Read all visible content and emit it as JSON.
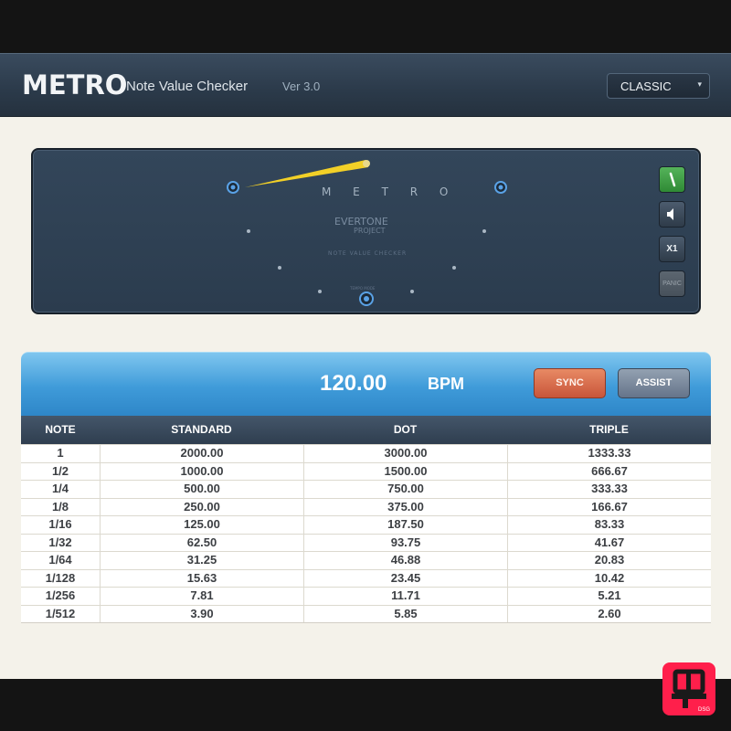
{
  "header": {
    "title": "METRO",
    "subtitle": "Note Value Checker",
    "version": "Ver 3.0",
    "mode_select": {
      "value": "CLASSIC",
      "arrow": "▾"
    }
  },
  "meter": {
    "brand": "M E T R O",
    "logo_line1": "EVERTONE",
    "logo_line2": "PROJECT",
    "subtitle": "NOTE VALUE CHECKER",
    "tempo_label": "TEMPO MODE",
    "buttons": {
      "metronome_icon": "metronome-icon",
      "sound_icon": "speaker-icon",
      "x1_label": "X1",
      "panic_label": "PANIC"
    },
    "needle_color": "#f2d027"
  },
  "bpm": {
    "value": "120.00",
    "unit": "BPM",
    "sync_label": "SYNC",
    "assist_label": "ASSIST"
  },
  "table": {
    "headers": [
      "NOTE",
      "STANDARD",
      "DOT",
      "TRIPLE"
    ],
    "rows": [
      [
        "1",
        "2000.00",
        "3000.00",
        "1333.33"
      ],
      [
        "1/2",
        "1000.00",
        "1500.00",
        "666.67"
      ],
      [
        "1/4",
        "500.00",
        "750.00",
        "333.33"
      ],
      [
        "1/8",
        "250.00",
        "375.00",
        "166.67"
      ],
      [
        "1/16",
        "125.00",
        "187.50",
        "83.33"
      ],
      [
        "1/32",
        "62.50",
        "93.75",
        "41.67"
      ],
      [
        "1/64",
        "31.25",
        "46.88",
        "20.83"
      ],
      [
        "1/128",
        "15.63",
        "23.45",
        "10.42"
      ],
      [
        "1/256",
        "7.81",
        "11.71",
        "5.21"
      ],
      [
        "1/512",
        "3.90",
        "5.85",
        "2.60"
      ]
    ]
  },
  "badge": {
    "text": "DSG"
  }
}
